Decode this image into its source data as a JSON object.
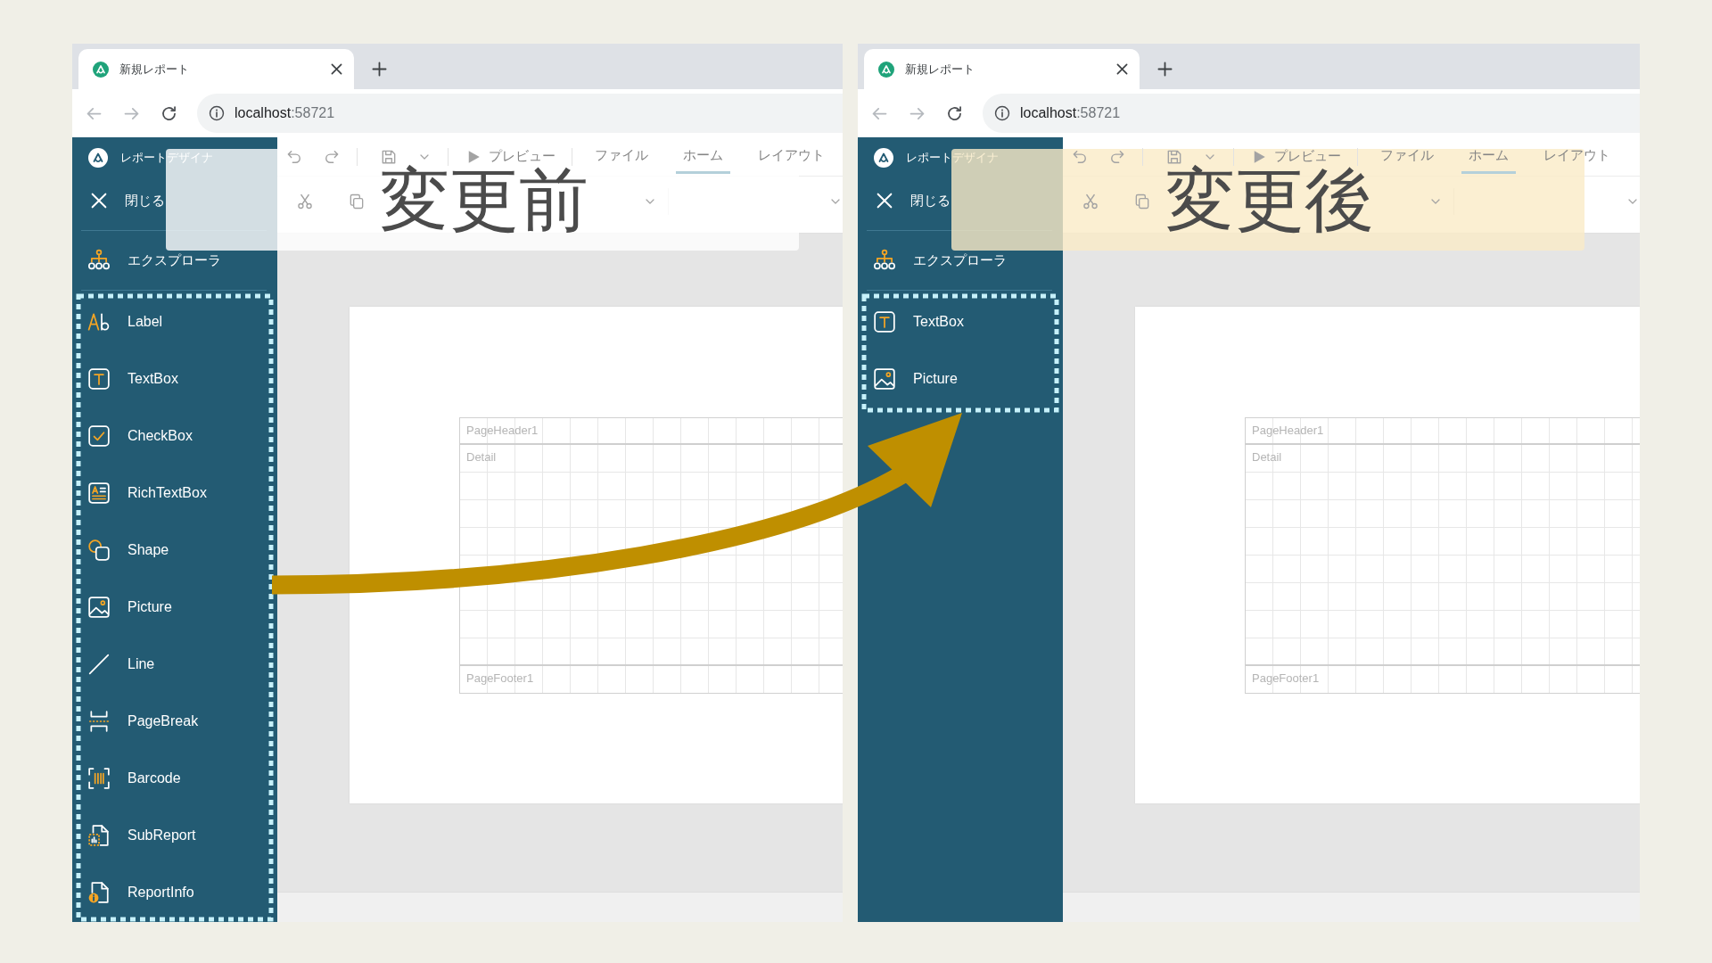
{
  "windows": [
    {
      "caption": {
        "text": "変更前",
        "kind": "before"
      },
      "tab": {
        "title": "新規レポート"
      },
      "nav": [
        {
          "kind": "back",
          "disabled": true
        },
        {
          "kind": "forward",
          "disabled": true
        },
        {
          "kind": "reload",
          "disabled": false
        }
      ],
      "address": {
        "host": "localhost",
        "port": ":58721"
      },
      "sidebar": {
        "app_title": "レポートデザイナ",
        "close_label": "閉じる",
        "explorer_label": "エクスプローラ",
        "tools": [
          {
            "kind": "label",
            "label": "Label"
          },
          {
            "kind": "textbox",
            "label": "TextBox"
          },
          {
            "kind": "checkbox",
            "label": "CheckBox"
          },
          {
            "kind": "richtextbox",
            "label": "RichTextBox"
          },
          {
            "kind": "shape",
            "label": "Shape"
          },
          {
            "kind": "picture",
            "label": "Picture"
          },
          {
            "kind": "line",
            "label": "Line"
          },
          {
            "kind": "pagebreak",
            "label": "PageBreak"
          },
          {
            "kind": "barcode",
            "label": "Barcode"
          },
          {
            "kind": "subreport",
            "label": "SubReport"
          },
          {
            "kind": "reportinfo",
            "label": "ReportInfo"
          }
        ]
      },
      "toolbar": {
        "preview": "プレビュー",
        "tabs": [
          {
            "label": "ファイル",
            "selected": false
          },
          {
            "label": "ホーム",
            "selected": true
          },
          {
            "label": "レイアウト",
            "selected": false
          }
        ]
      },
      "bands": [
        {
          "kind": "header",
          "label": "PageHeader1"
        },
        {
          "kind": "detail",
          "label": "Detail"
        },
        {
          "kind": "footer",
          "label": "PageFooter1"
        }
      ]
    },
    {
      "caption": {
        "text": "変更後",
        "kind": "after"
      },
      "tab": {
        "title": "新規レポート"
      },
      "nav": [
        {
          "kind": "back",
          "disabled": true
        },
        {
          "kind": "forward",
          "disabled": true
        },
        {
          "kind": "reload",
          "disabled": false
        }
      ],
      "address": {
        "host": "localhost",
        "port": ":58721"
      },
      "sidebar": {
        "app_title": "レポートデザイナ",
        "close_label": "閉じる",
        "explorer_label": "エクスプローラ",
        "tools": [
          {
            "kind": "textbox",
            "label": "TextBox"
          },
          {
            "kind": "picture",
            "label": "Picture"
          }
        ]
      },
      "toolbar": {
        "preview": "プレビュー",
        "tabs": [
          {
            "label": "ファイル",
            "selected": false
          },
          {
            "label": "ホーム",
            "selected": true
          },
          {
            "label": "レイアウト",
            "selected": false
          }
        ]
      },
      "bands": [
        {
          "kind": "header",
          "label": "PageHeader1"
        },
        {
          "kind": "detail",
          "label": "Detail"
        },
        {
          "kind": "footer",
          "label": "PageFooter1"
        }
      ]
    }
  ]
}
